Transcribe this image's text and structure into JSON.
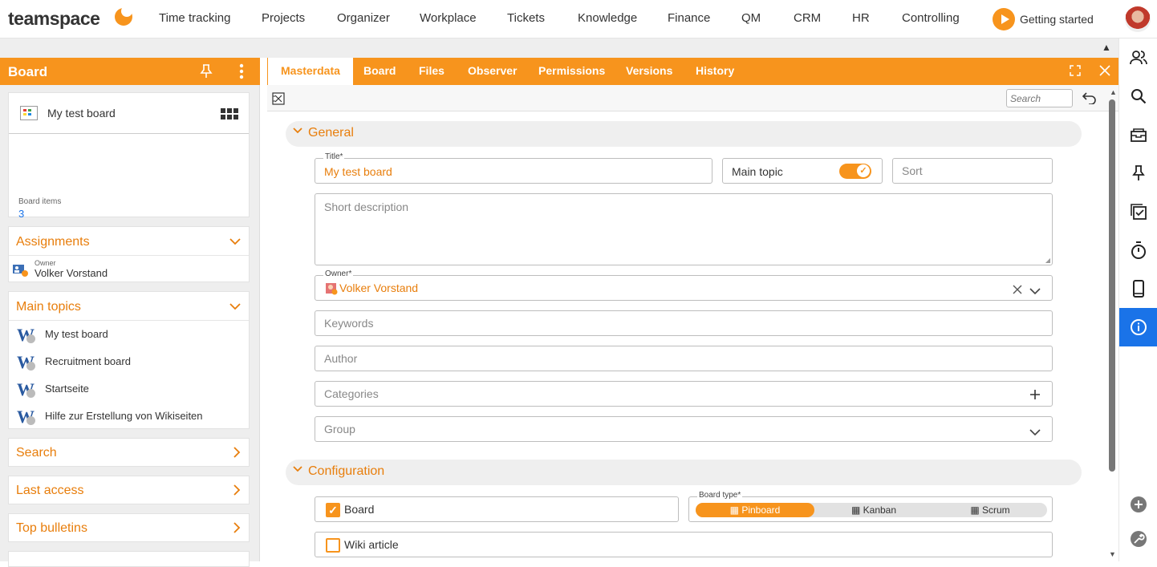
{
  "app": {
    "logo": "teamspace"
  },
  "topnav": [
    {
      "label": "Time tracking"
    },
    {
      "label": "Projects"
    },
    {
      "label": "Organizer"
    },
    {
      "label": "Workplace"
    },
    {
      "label": "Tickets"
    },
    {
      "label": "Knowledge"
    },
    {
      "label": "Finance"
    },
    {
      "label": "QM"
    },
    {
      "label": "CRM"
    },
    {
      "label": "HR"
    },
    {
      "label": "Controlling"
    }
  ],
  "getting_started": "Getting started",
  "left": {
    "header": "Board",
    "board_card": {
      "title": "My test board",
      "items_label": "Board items",
      "items_count": "3"
    },
    "assignments": {
      "title": "Assignments",
      "owner_label": "Owner",
      "owner_name": "Volker Vorstand"
    },
    "main_topics": {
      "title": "Main topics",
      "items": [
        {
          "label": "My test board"
        },
        {
          "label": "Recruitment board"
        },
        {
          "label": "Startseite"
        },
        {
          "label": "Hilfe zur Erstellung von Wikiseiten"
        }
      ]
    },
    "search": "Search",
    "last_access": "Last access",
    "top_bulletins": "Top bulletins"
  },
  "tabs": [
    {
      "label": "Masterdata"
    },
    {
      "label": "Board"
    },
    {
      "label": "Files"
    },
    {
      "label": "Observer"
    },
    {
      "label": "Permissions"
    },
    {
      "label": "Versions"
    },
    {
      "label": "History"
    }
  ],
  "toolbar": {
    "search_placeholder": "Search"
  },
  "general": {
    "title": "General",
    "title_label": "Title*",
    "title_value": "My test board",
    "main_topic_label": "Main topic",
    "main_topic_on": true,
    "sort_placeholder": "Sort",
    "short_description_placeholder": "Short description",
    "owner_label": "Owner*",
    "owner_value": "Volker Vorstand",
    "keywords_placeholder": "Keywords",
    "author_placeholder": "Author",
    "categories_placeholder": "Categories",
    "group_placeholder": "Group"
  },
  "configuration": {
    "title": "Configuration",
    "board_label": "Board",
    "board_checked": true,
    "board_type_label": "Board type*",
    "board_types": [
      {
        "label": "Pinboard",
        "selected": true
      },
      {
        "label": "Kanban",
        "selected": false
      },
      {
        "label": "Scrum",
        "selected": false
      }
    ],
    "wiki_label": "Wiki article",
    "wiki_checked": false
  },
  "colors": {
    "accent": "#f7941d",
    "rail_active": "#1a73e8"
  }
}
